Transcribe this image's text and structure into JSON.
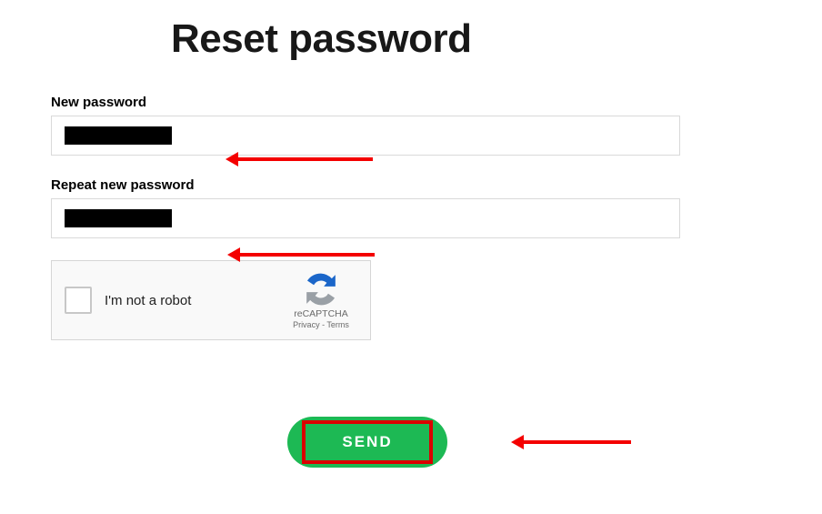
{
  "page": {
    "title": "Reset password"
  },
  "fields": {
    "new_password": {
      "label": "New password",
      "value_redacted": true
    },
    "repeat_password": {
      "label": "Repeat new password",
      "value_redacted": true
    }
  },
  "recaptcha": {
    "label": "I'm not a robot",
    "badge": "reCAPTCHA",
    "privacy": "Privacy",
    "terms": "Terms",
    "separator": " - "
  },
  "buttons": {
    "send": "SEND"
  },
  "colors": {
    "accent": "#1db954",
    "annotation": "#f40000"
  }
}
